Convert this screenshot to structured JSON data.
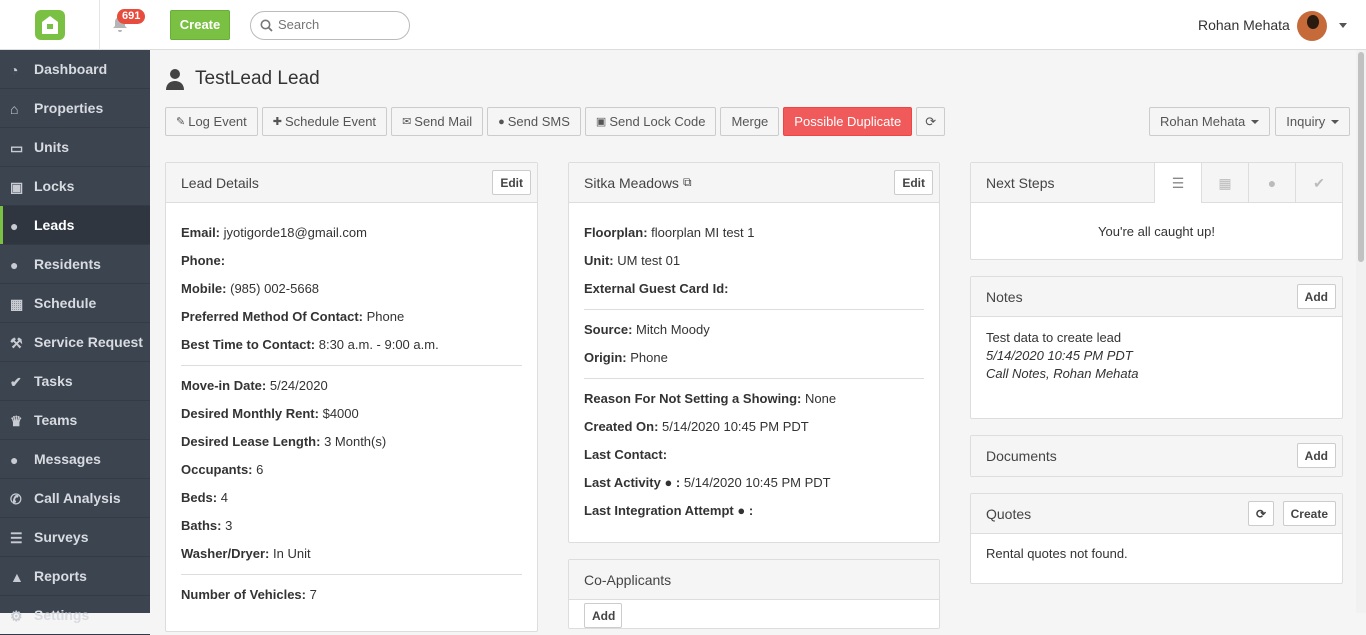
{
  "topbar": {
    "notifications_count": "691",
    "create_label": "Create",
    "search_placeholder": "Search",
    "user_name": "Rohan Mehata"
  },
  "sidebar": {
    "items": [
      {
        "label": "Dashboard",
        "icon": "dashboard-icon"
      },
      {
        "label": "Properties",
        "icon": "home-icon"
      },
      {
        "label": "Units",
        "icon": "bed-icon"
      },
      {
        "label": "Locks",
        "icon": "lock-icon"
      },
      {
        "label": "Leads",
        "icon": "users-icon",
        "active": true
      },
      {
        "label": "Residents",
        "icon": "users-icon"
      },
      {
        "label": "Schedule",
        "icon": "calendar-icon"
      },
      {
        "label": "Service Request",
        "icon": "wrench-icon"
      },
      {
        "label": "Tasks",
        "icon": "check-icon"
      },
      {
        "label": "Teams",
        "icon": "trophy-icon"
      },
      {
        "label": "Messages",
        "icon": "comments-icon"
      },
      {
        "label": "Call Analysis",
        "icon": "phone-icon"
      },
      {
        "label": "Surveys",
        "icon": "sliders-icon"
      },
      {
        "label": "Reports",
        "icon": "chart-icon"
      },
      {
        "label": "Settings",
        "icon": "gear-icon"
      }
    ]
  },
  "page": {
    "title": "TestLead Lead"
  },
  "toolbar": {
    "log_event": "Log Event",
    "schedule_event": "Schedule Event",
    "send_mail": "Send Mail",
    "send_sms": "Send SMS",
    "send_lock_code": "Send Lock Code",
    "merge": "Merge",
    "possible_duplicate": "Possible Duplicate",
    "agent_select": "Rohan Mehata",
    "status_select": "Inquiry"
  },
  "lead_details": {
    "title": "Lead Details",
    "edit": "Edit",
    "email_label": "Email:",
    "email": "jyotigorde18@gmail.com",
    "phone_label": "Phone:",
    "phone": "",
    "mobile_label": "Mobile:",
    "mobile": "(985) 002-5668",
    "pmoc_label": "Preferred Method Of Contact:",
    "pmoc": "Phone",
    "btc_label": "Best Time to Contact:",
    "btc": "8:30 a.m. - 9:00 a.m.",
    "movein_label": "Move-in Date:",
    "movein": "5/24/2020",
    "rent_label": "Desired Monthly Rent:",
    "rent": "$4000",
    "lease_label": "Desired Lease Length:",
    "lease": "3 Month(s)",
    "occupants_label": "Occupants:",
    "occupants": "6",
    "beds_label": "Beds:",
    "beds": "4",
    "baths_label": "Baths:",
    "baths": "3",
    "washer_label": "Washer/Dryer:",
    "washer": "In Unit",
    "vehicles_label": "Number of Vehicles:",
    "vehicles": "7"
  },
  "property": {
    "title": "Sitka Meadows",
    "edit": "Edit",
    "floorplan_label": "Floorplan:",
    "floorplan": "floorplan MI test 1",
    "unit_label": "Unit:",
    "unit": "UM test 01",
    "egc_label": "External Guest Card Id:",
    "egc": "",
    "source_label": "Source:",
    "source": "Mitch Moody",
    "origin_label": "Origin:",
    "origin": "Phone",
    "reason_label": "Reason For Not Setting a Showing:",
    "reason": "None",
    "created_label": "Created On:",
    "created": "5/14/2020 10:45 PM PDT",
    "last_contact_label": "Last Contact:",
    "last_contact": "",
    "last_activity_label": "Last Activity",
    "last_activity": "5/14/2020 10:45 PM PDT",
    "last_integration_label": "Last Integration Attempt",
    "last_integration": ""
  },
  "co_applicants": {
    "title": "Co-Applicants",
    "add": "Add"
  },
  "next_steps": {
    "title": "Next Steps",
    "message": "You're all caught up!"
  },
  "notes": {
    "title": "Notes",
    "add": "Add",
    "text": "Test data to create lead",
    "date": "5/14/2020 10:45 PM PDT",
    "meta": "Call Notes, Rohan Mehata"
  },
  "documents": {
    "title": "Documents",
    "add": "Add"
  },
  "quotes": {
    "title": "Quotes",
    "create": "Create",
    "empty": "Rental quotes not found."
  }
}
